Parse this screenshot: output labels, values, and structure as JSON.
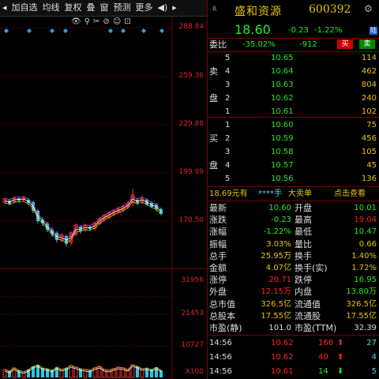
{
  "toolbar": {
    "items": [
      "加自选",
      "均线",
      "复权",
      "叠",
      "窗",
      "预测",
      "更多"
    ],
    "arrow_left": "◂",
    "speaker": "◀)",
    "arrow_right": "▸"
  },
  "chart": {
    "tools": [
      "👁",
      "⚲",
      "✂",
      "⊘",
      "☺",
      "⊡"
    ],
    "price_axis": [
      "288.84",
      "259.36",
      "229.88",
      "199.99",
      "170.50"
    ],
    "volume_axis": [
      "31956",
      "21453",
      "10727",
      "X100"
    ]
  },
  "header": {
    "name": "盛和资源",
    "code": "600392",
    "price": "18.60",
    "change": "-0.23",
    "change_pct": "-1.22%",
    "tag": "陆"
  },
  "weibi": {
    "label": "委比",
    "pct": "-35.02%",
    "diff": "-912",
    "buy_btn": "买",
    "sell_btn": "卖"
  },
  "sell": [
    {
      "l1": "",
      "l2": "5",
      "price": "10.65",
      "vol": "114"
    },
    {
      "l1": "卖",
      "l2": "4",
      "price": "10.64",
      "vol": "462"
    },
    {
      "l1": "",
      "l2": "3",
      "price": "10.63",
      "vol": "804"
    },
    {
      "l1": "盘",
      "l2": "2",
      "price": "10.62",
      "vol": "240"
    },
    {
      "l1": "",
      "l2": "1",
      "price": "10.61",
      "vol": "102"
    }
  ],
  "buy": [
    {
      "l1": "",
      "l2": "1",
      "price": "10.60",
      "vol": "75"
    },
    {
      "l1": "买",
      "l2": "2",
      "price": "10.59",
      "vol": "456"
    },
    {
      "l1": "",
      "l2": "3",
      "price": "10.58",
      "vol": "105"
    },
    {
      "l1": "盘",
      "l2": "4",
      "price": "10.57",
      "vol": "45"
    },
    {
      "l1": "",
      "l2": "5",
      "price": "10.56",
      "vol": "136"
    }
  ],
  "bigorder": {
    "price": "18.69元有",
    "stars": "****手",
    "label": "大卖单",
    "link": "点击查看"
  },
  "stats": [
    {
      "k1": "最新",
      "v1": "10.60",
      "c1": "g",
      "k2": "开盘",
      "v2": "10.01",
      "c2": "g"
    },
    {
      "k1": "涨跌",
      "v1": "-0.23",
      "c1": "g",
      "k2": "最高",
      "v2": "19.04",
      "c2": "r"
    },
    {
      "k1": "涨幅",
      "v1": "-1.22%",
      "c1": "g",
      "k2": "最低",
      "v2": "10.47",
      "c2": "g"
    },
    {
      "k1": "振幅",
      "v1": "3.03%",
      "c1": "y",
      "k2": "量比",
      "v2": "0.66",
      "c2": "y"
    },
    {
      "k1": "总手",
      "v1": "25.95万",
      "c1": "y",
      "k2": "换手",
      "v2": "1.40%",
      "c2": "y"
    },
    {
      "k1": "金额",
      "v1": "4.07亿",
      "c1": "y",
      "k2": "换手(实)",
      "v2": "1.72%",
      "c2": "y"
    },
    {
      "k1": "涨停",
      "v1": "20.71",
      "c1": "r",
      "k2": "跌停",
      "v2": "16.95",
      "c2": "g"
    },
    {
      "k1": "外盘",
      "v1": "12.15万",
      "c1": "r",
      "k2": "内盘",
      "v2": "13.80万",
      "c2": "g"
    },
    {
      "k1": "总市值",
      "v1": "326.5亿",
      "c1": "y",
      "k2": "流通值",
      "v2": "326.5亿",
      "c2": "y"
    },
    {
      "k1": "总股本",
      "v1": "17.55亿",
      "c1": "y",
      "k2": "流通股",
      "v2": "17.55亿",
      "c2": "y"
    },
    {
      "k1": "市盈(静)",
      "v1": "101.0",
      "c1": "w",
      "k2": "市盈(TTM)",
      "v2": "32.39",
      "c2": "w"
    }
  ],
  "ticks": [
    {
      "time": "14:56",
      "price": "10.62",
      "vol": "166",
      "dir": "up",
      "n": "27"
    },
    {
      "time": "14:56",
      "price": "10.62",
      "vol": "40",
      "dir": "up",
      "n": "4"
    },
    {
      "time": "14:56",
      "price": "10.61",
      "vol": "14",
      "dir": "down",
      "n": "5"
    }
  ]
}
